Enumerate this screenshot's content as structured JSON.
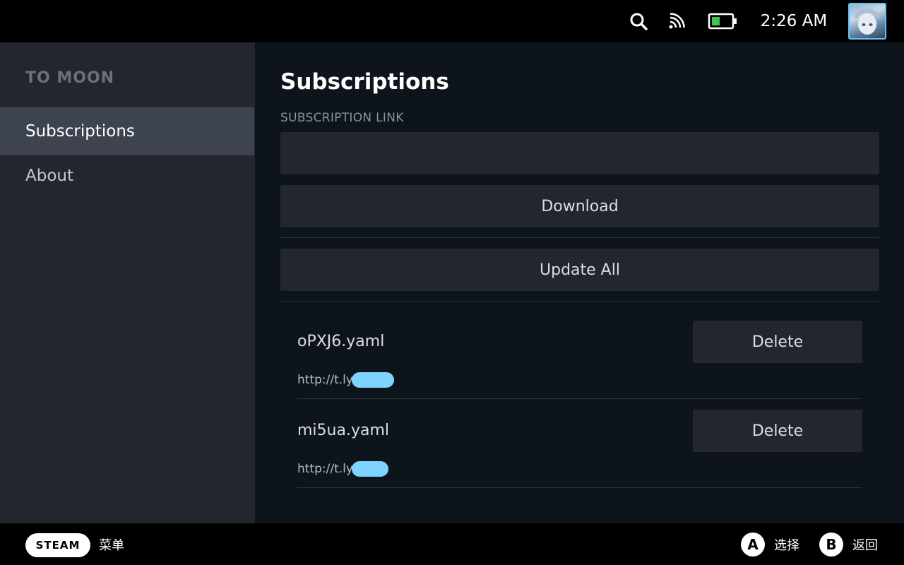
{
  "status_bar": {
    "time": "2:26 AM",
    "icons": [
      "search-icon",
      "cast-icon",
      "battery-icon"
    ],
    "battery_color": "#3fc64f"
  },
  "sidebar": {
    "app_title": "TO MOON",
    "items": [
      {
        "label": "Subscriptions",
        "active": true
      },
      {
        "label": "About",
        "active": false
      }
    ]
  },
  "main": {
    "title": "Subscriptions",
    "subscription_link": {
      "label": "SUBSCRIPTION LINK",
      "value": "",
      "placeholder": ""
    },
    "download_label": "Download",
    "update_all_label": "Update All",
    "subscriptions": [
      {
        "name": "oPXJ6.yaml",
        "url": "http://t.ly/",
        "delete_label": "Delete"
      },
      {
        "name": "mi5ua.yaml",
        "url": "http://t.ly/",
        "delete_label": "Delete"
      }
    ]
  },
  "footer": {
    "steam_label": "STEAM",
    "menu_label": "菜单",
    "select_button": "A",
    "select_label": "选择",
    "back_button": "B",
    "back_label": "返回"
  },
  "colors": {
    "background": "#0e141b",
    "sidebar": "#23262e",
    "active_item": "#3d4450",
    "button": "#23262e",
    "redaction": "#7fd4ff"
  }
}
